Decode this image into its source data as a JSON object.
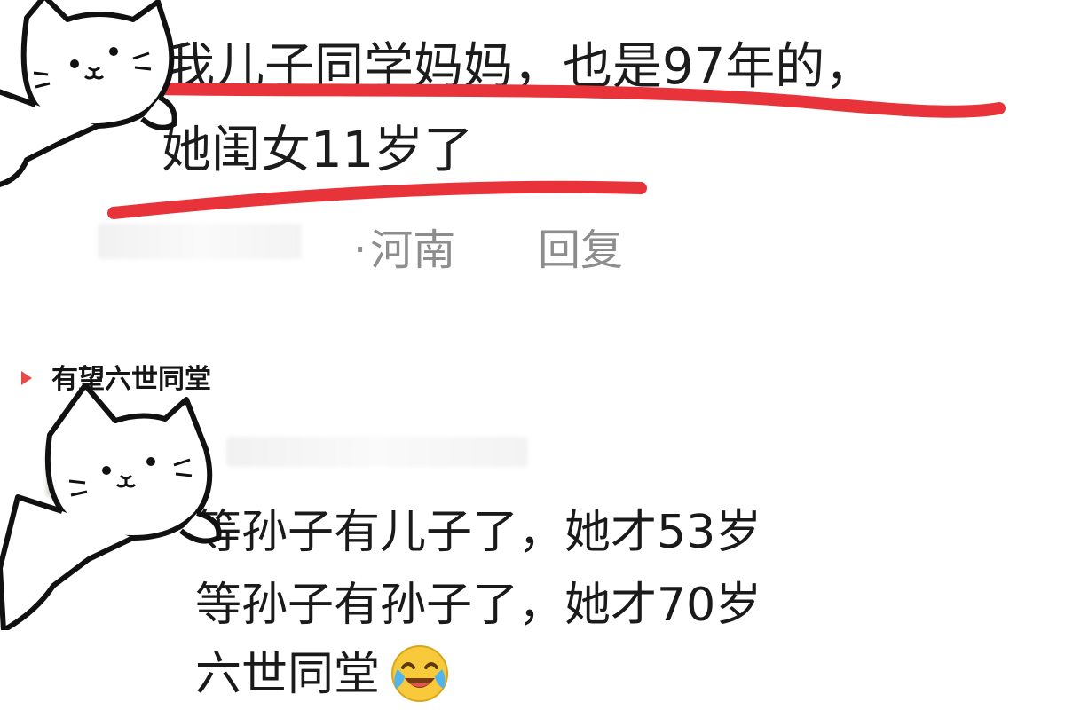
{
  "comment": {
    "line1": "我儿子同学妈妈，也是97年的，",
    "line2": "她闺女11岁了",
    "location_dot": "·",
    "location": "河南",
    "reply_label": "回复"
  },
  "thread": {
    "title": "有望六世同堂"
  },
  "reply": {
    "lines": [
      "等孙子有儿子了，她才53岁",
      "等孙子有孙子了，她才70岁",
      "六世同堂"
    ],
    "emoji": "crying-laughing-emoji"
  },
  "colors": {
    "underline_red": "#e8333a",
    "meta_gray": "#8d8d8d",
    "thread_marker": "#e84a4a"
  },
  "stickers": [
    "cat-sticker",
    "cat-sticker"
  ]
}
